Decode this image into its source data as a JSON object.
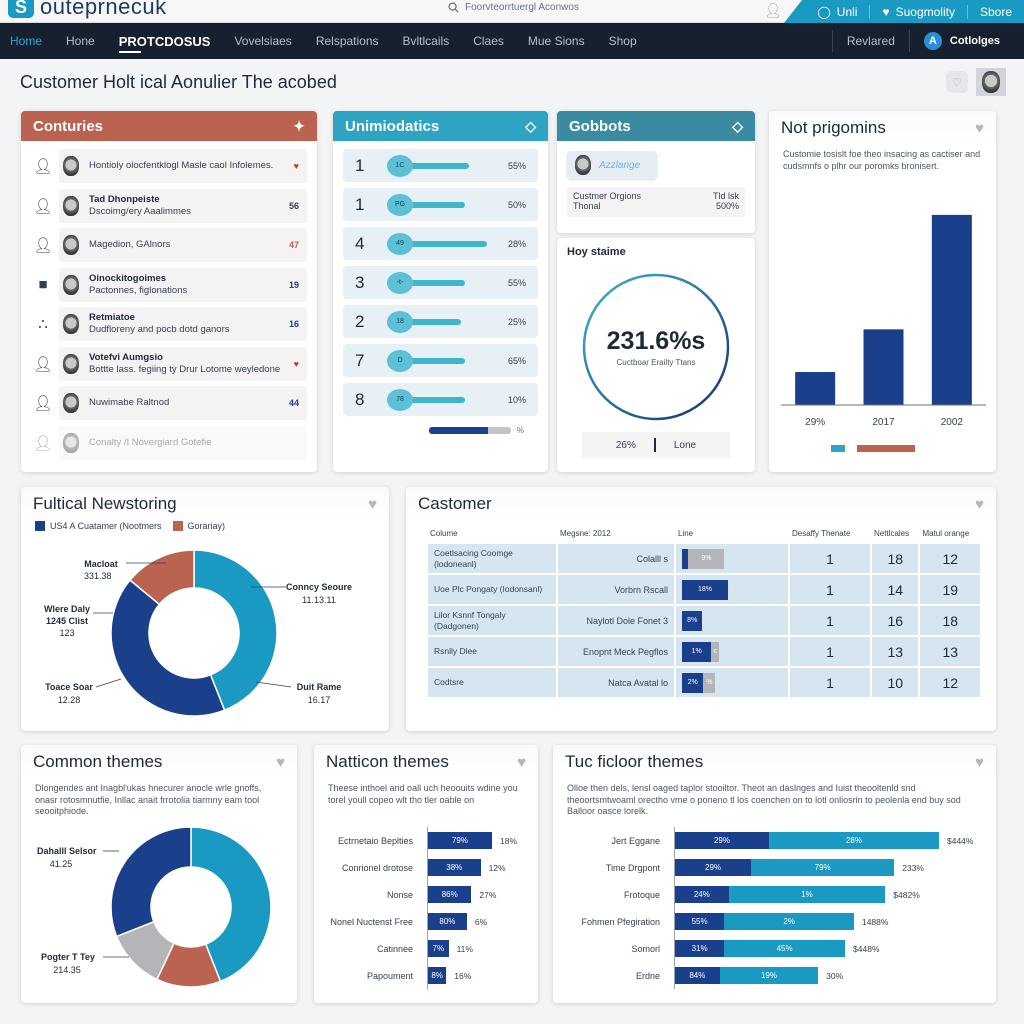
{
  "app": {
    "logo_mark": "S",
    "logo_text": "outeprnecuk",
    "search_placeholder": "Foorvteorrtuergl Aconwos"
  },
  "top_right": [
    {
      "icon": "clock-icon",
      "label": "Unli"
    },
    {
      "icon": "heart-icon",
      "label": "Suogmolity"
    },
    {
      "icon": "",
      "label": "Sbore"
    }
  ],
  "nav": {
    "items": [
      "Home",
      "Hone",
      "PROTCDOSUS",
      "Vovelsiaes",
      "Relspations",
      "Bvltlcails",
      "Claes",
      "Mue Sions",
      "Shop"
    ],
    "active_index": 2,
    "right_items": [
      {
        "label": "Revlared"
      },
      {
        "label": "Cotlolges",
        "badge": "A"
      }
    ]
  },
  "page": {
    "title": "Customer Holt ical Aonulier The acobed"
  },
  "colors": {
    "rust": "#b96350",
    "teal": "#2fa3c2",
    "steel_teal": "#3a8ba2",
    "navy": "#1a3f8b",
    "cyan": "#1a9ac2",
    "gray": "#b3b5b8"
  },
  "conturies": {
    "title": "Conturies",
    "rows": [
      {
        "icon": "user-icon",
        "line1": "",
        "line2": "Hontioly olocfentklogl Masle caol Infolemes.",
        "meta": "♥",
        "meta_color": "#c0392b"
      },
      {
        "icon": "user-icon",
        "line1": "Tad Dhonpeiste",
        "line2": "Dscoimg/ery Aaalimmes",
        "meta": "56",
        "meta_color": "#374151"
      },
      {
        "icon": "user-icon",
        "line1": "",
        "line2": "Magedion, GAlnors",
        "meta": "47",
        "meta_color": "#b96350"
      },
      {
        "icon": "briefcase-icon",
        "line1": "Oinockitogoimes",
        "line2": "Pactonnes, figlonations",
        "meta": "19",
        "meta_color": "#1a3f8b"
      },
      {
        "icon": "group-icon",
        "line1": "Retmiatoe",
        "line2": "Dudfloreny and pocb dotd ganors",
        "meta": "16",
        "meta_color": "#1a3f8b"
      },
      {
        "icon": "user-icon",
        "line1": "Votefvi Aumgsio",
        "line2": "Bottte lass. fegiing ty Drur Lotome weyledone",
        "meta": "♥",
        "meta_color": "#c0392b"
      },
      {
        "icon": "user-icon",
        "line1": "",
        "line2": "Nuwimabe Raltnod",
        "meta": "44",
        "meta_color": "#1a3f8b"
      },
      {
        "icon": "user-icon",
        "line1": "",
        "line2": "Conalty /I Novergiard Gotefie",
        "meta": "",
        "meta_color": "#374151",
        "faded": true
      }
    ]
  },
  "unimiodatics": {
    "title": "Unimiodatics",
    "rows": [
      {
        "rank": "1",
        "tag": "1C",
        "value": 0.72,
        "pct": "55%"
      },
      {
        "rank": "1",
        "tag": "PG",
        "value": 0.68,
        "pct": "50%"
      },
      {
        "rank": "4",
        "tag": "49",
        "value": 0.9,
        "pct": "28%"
      },
      {
        "rank": "3",
        "tag": "-t-",
        "value": 0.68,
        "pct": "55%"
      },
      {
        "rank": "2",
        "tag": "18",
        "value": 0.64,
        "pct": "25%"
      },
      {
        "rank": "7",
        "tag": "D",
        "value": 0.68,
        "pct": "65%"
      },
      {
        "rank": "8",
        "tag": "78",
        "value": 0.68,
        "pct": "10%"
      }
    ],
    "summary_fill": 0.72,
    "summary_unit": "%"
  },
  "gobbots": {
    "title": "Gobbots",
    "chip_label": "Azzlange",
    "table": {
      "left1": "Custmer Orgions",
      "left2": "Thonal",
      "right1": "Tld lsk",
      "right2": "500%"
    },
    "section_label": "Hoy staime",
    "ring_value": "231.6%s",
    "ring_label": "Cuctboar Erailty Ttans",
    "ring_fill": 1.0,
    "foot_left": "26%",
    "foot_right": "Lone"
  },
  "not_prigomins": {
    "title": "Not prigomins",
    "description": "Customie tosislt foe theo insacing as cactiser and cudsmnfs o plhr our poromks bronisert.",
    "chart_data": {
      "type": "bar",
      "categories": [
        "29%",
        "2017",
        "2002"
      ],
      "values": [
        17,
        39,
        98
      ],
      "ylim": [
        0,
        100
      ],
      "legend": [
        {
          "color": "#2fa3c2"
        },
        {
          "color": "#b96350"
        }
      ]
    }
  },
  "fultical": {
    "title": "Fultical Newstoring",
    "legend": [
      {
        "color": "#1a3f8b",
        "label": "US4 A Cuatamer (Nootmers"
      },
      {
        "color": "#b96350",
        "label": "Gorariay)"
      }
    ],
    "chart_data": {
      "type": "pie",
      "slices": [
        {
          "label": "Conncy Seoure",
          "value_text": "11.13.11",
          "value": 44,
          "color": "#1a9ac2"
        },
        {
          "label": "Toace Soar",
          "value_text": "12.28",
          "value": 42,
          "color": "#1a3f8b"
        },
        {
          "label": "Macloat",
          "value_text": "331.38",
          "value": 14,
          "color": "#b96350"
        }
      ],
      "extra_labels": [
        {
          "label": "Wlere Daly 1245 Clist",
          "value_text": "123"
        },
        {
          "label": "Duit Rame",
          "value_text": "16.17"
        }
      ]
    }
  },
  "customer": {
    "title": "Castomer",
    "columns": [
      "Colume",
      "Megsne: 2012",
      "Line",
      "Desaffy Thenate",
      "Nettlcales",
      "Matul orange"
    ],
    "rows": [
      {
        "name": "Coetlsacing Coomge (lodoneanl)",
        "mag": "Colalll s",
        "bar_a": 0.1,
        "bar_a_label": "",
        "bar_b": 0.9,
        "bar_b_label": "9%",
        "c4": "1",
        "c5": "18",
        "c6": "12"
      },
      {
        "name": "Uoe Plc Pongaty (Iodonsanl)",
        "mag": "Vorbrn Rscall",
        "bar_a": 1.0,
        "bar_a_label": "18%",
        "bar_b": 0,
        "bar_b_label": "",
        "c4": "1",
        "c5": "14",
        "c6": "19"
      },
      {
        "name": "Lilor Ksnnf Tongaly (Dadgonen)",
        "mag": "Naylotl Dole Fonet 3",
        "bar_a": 0.42,
        "bar_a_label": "8%",
        "bar_b": 0,
        "bar_b_label": "",
        "c4": "1",
        "c5": "16",
        "c6": "18"
      },
      {
        "name": "Rsnlly Dlee",
        "mag": "Enopnt Meck Pegflos",
        "bar_a": 0.62,
        "bar_a_label": "1%",
        "bar_b": 0.2,
        "bar_b_label": "c",
        "c4": "1",
        "c5": "13",
        "c6": "13"
      },
      {
        "name": "Codtsre",
        "mag": "Natca Avatal lo",
        "bar_a": 0.44,
        "bar_a_label": "2%",
        "bar_b": 0.3,
        "bar_b_label": "%",
        "c4": "1",
        "c5": "10",
        "c6": "12"
      }
    ]
  },
  "common_themes": {
    "title": "Common themes",
    "description": "Dlongendes ant Inagbl'ukas hnecurer anocle wrle gnoffs, onasr rotosmnutfie, Inllac anait frrotolia tiarmny eam tool seooitphiode.",
    "chart_data": {
      "type": "pie",
      "slices": [
        {
          "label": "",
          "value": 44,
          "color": "#1a9ac2"
        },
        {
          "label": "",
          "value": 13,
          "color": "#b96350"
        },
        {
          "label": "Pogter T Tey",
          "value_text": "214.35",
          "value": 12,
          "color": "#b3b5b8"
        },
        {
          "label": "Dahalll Selsor",
          "value_text": "41.25",
          "value": 31,
          "color": "#1a3f8b"
        }
      ]
    }
  },
  "natticon_themes": {
    "title": "Natticon themes",
    "description": "Theese inthoel and oall uch heoouits wdine you torel youll copeo wlt tho tler oable on",
    "chart_data": {
      "type": "bar",
      "orientation": "horizontal",
      "categories": [
        "Ectrnetaio Beplties",
        "Conrionel drotose",
        "Nonse",
        "Nonel Nuctenst Free",
        "Catinnee",
        "Papoument"
      ],
      "values": [
        28,
        23,
        19,
        17,
        9,
        8
      ],
      "bar_labels": [
        "79%",
        "38%",
        "86%",
        "80%",
        "7%",
        "8%"
      ],
      "end_labels": [
        "18%",
        "12%",
        "27%",
        "6%",
        "11%",
        "16%"
      ]
    }
  },
  "tucficloor_themes": {
    "title": "Tuc ficloor themes",
    "description": "Olloe then dels, lensl oaged taplor stooiltor. Theot an daslnges and Iuist theooltenld snd theoortsmtwoaml orectho vme o poneno tl los coenchen on to lotl onliosrin to peolenla end buy sod Balloor oasce lorelk.",
    "chart_data": {
      "type": "bar",
      "orientation": "horizontal",
      "stacked": true,
      "categories": [
        "Jert Eggane",
        "Time Drgpont",
        "Frotoque",
        "Fohmen Pfegiration",
        "Somorl",
        "Erdne"
      ],
      "series": [
        {
          "name": "dark",
          "color": "#1a3f8b",
          "values": [
            21,
            17,
            12,
            11,
            11,
            10
          ],
          "labels": [
            "29%",
            "29%",
            "24%",
            "55%",
            "31%",
            "84%"
          ]
        },
        {
          "name": "light",
          "color": "#1a9ac2",
          "values": [
            38,
            32,
            35,
            29,
            27,
            22
          ],
          "labels": [
            "28%",
            "79%",
            "1%",
            "2%",
            "45%",
            "19%"
          ]
        }
      ],
      "end_labels": [
        "$444%",
        "233%",
        "$482%",
        "1488%",
        "$448%",
        "30%"
      ]
    }
  }
}
